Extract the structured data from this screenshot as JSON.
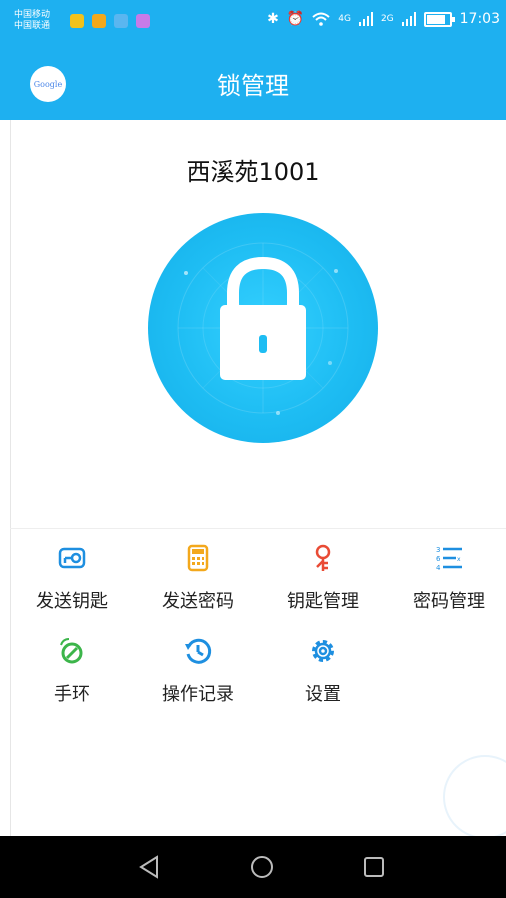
{
  "status_bar": {
    "carrier_1": "中国移动",
    "carrier_2": "中国联通",
    "signal_4g": "4G",
    "signal_2g": "2G",
    "time": "17:03"
  },
  "header": {
    "title": "锁管理",
    "left_icon": "google-icon"
  },
  "lock": {
    "name": "西溪苑1001",
    "state_icon": "padlock-icon"
  },
  "menu": [
    {
      "label": "发送钥匙",
      "icon": "send-key-icon",
      "color": "#1e8fe0"
    },
    {
      "label": "发送密码",
      "icon": "send-password-icon",
      "color": "#f3a81c"
    },
    {
      "label": "钥匙管理",
      "icon": "key-manage-icon",
      "color": "#e94b35"
    },
    {
      "label": "密码管理",
      "icon": "password-manage-icon",
      "color": "#1e8fe0"
    },
    {
      "label": "手环",
      "icon": "wristband-icon",
      "color": "#3cb54a"
    },
    {
      "label": "操作记录",
      "icon": "history-icon",
      "color": "#1e8fe0"
    },
    {
      "label": "设置",
      "icon": "settings-icon",
      "color": "#1e8fe0"
    }
  ],
  "nav": {
    "back": "back-icon",
    "home": "home-icon",
    "recent": "recent-apps-icon"
  },
  "colors": {
    "primary": "#1eb0f0",
    "lock_circle": "#1ebdf3"
  }
}
